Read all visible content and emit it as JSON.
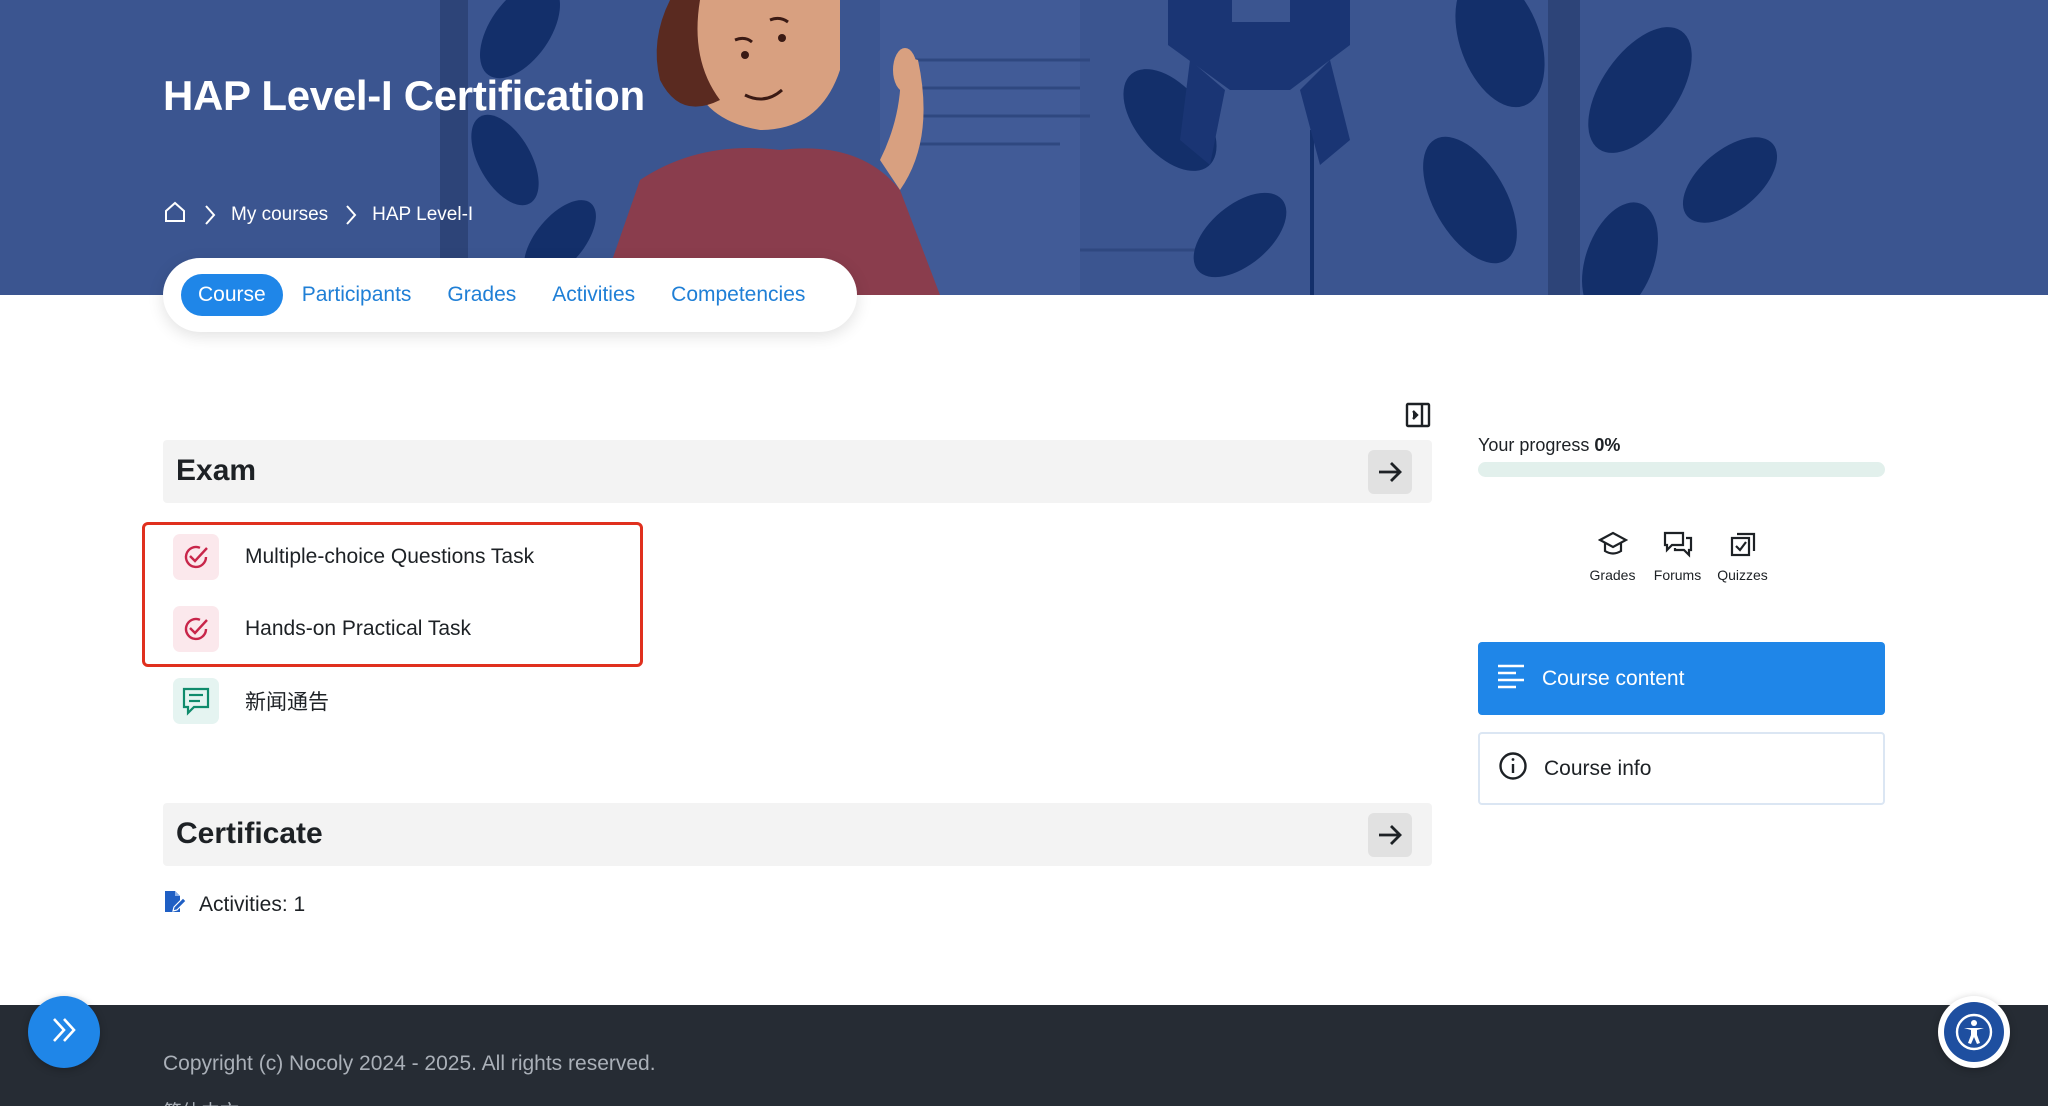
{
  "header": {
    "title": "HAP Level-I Certification",
    "breadcrumb": {
      "home_icon": "home-icon",
      "items": [
        "My courses",
        "HAP Level-I"
      ]
    }
  },
  "tabs": [
    {
      "label": "Course",
      "active": true
    },
    {
      "label": "Participants",
      "active": false
    },
    {
      "label": "Grades",
      "active": false
    },
    {
      "label": "Activities",
      "active": false
    },
    {
      "label": "Competencies",
      "active": false
    }
  ],
  "sections": [
    {
      "title": "Exam",
      "activities": [
        {
          "label": "Multiple-choice Questions Task",
          "icon": "assessment-check-icon"
        },
        {
          "label": "Hands-on Practical Task",
          "icon": "assessment-check-icon"
        },
        {
          "label": "新闻通告",
          "icon": "forum-icon"
        }
      ]
    },
    {
      "title": "Certificate",
      "activities_count": "Activities: 1"
    }
  ],
  "sidebar": {
    "progress_label": "Your progress",
    "progress_value": "0%",
    "progress_fraction": 0,
    "quick_links": [
      {
        "label": "Grades",
        "icon": "graduation-cap-icon"
      },
      {
        "label": "Forums",
        "icon": "forums-icon"
      },
      {
        "label": "Quizzes",
        "icon": "quizzes-icon"
      }
    ],
    "course_content_label": "Course content",
    "course_info_label": "Course info"
  },
  "footer": {
    "copyright": "Copyright (c) Nocoly 2024 - 2025. All rights reserved.",
    "language": "简体中文"
  },
  "colors": {
    "hero": "#3b5590",
    "primary": "#1f86e8",
    "assessment": "#c8264a",
    "communication": "#0f8b6c",
    "footer": "#262c34",
    "highlight": "#e0301e"
  }
}
